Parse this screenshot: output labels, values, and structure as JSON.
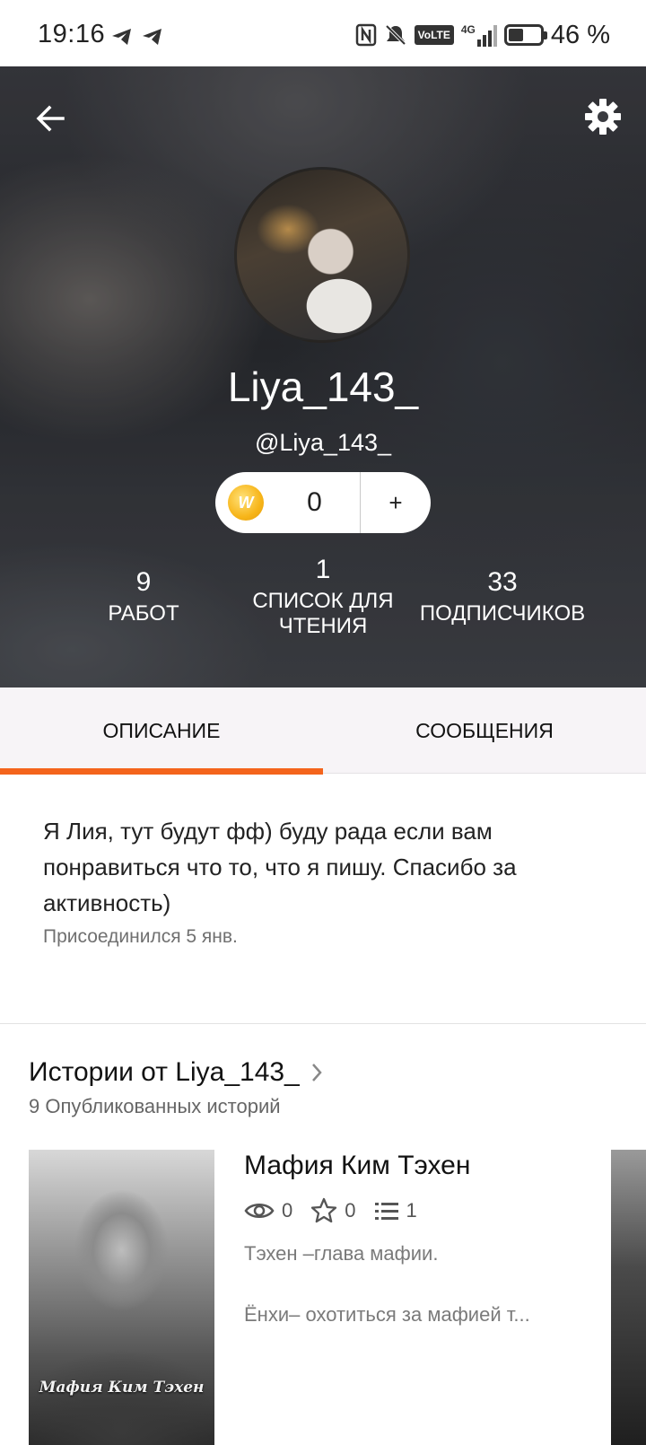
{
  "status_bar": {
    "time": "19:16",
    "volte": "VoLTE",
    "network": "4G",
    "battery": "46 %",
    "battery_level": 0.46
  },
  "header": {
    "display_name": "Liya_143_",
    "username": "@Liya_143_",
    "coins": {
      "count": "0",
      "add_label": "+",
      "coin_glyph": "W"
    },
    "stats": [
      {
        "num": "9",
        "label": "РАБОТ"
      },
      {
        "num": "1",
        "label_line1": "СПИСОК ДЛЯ",
        "label_line2": "ЧТЕНИЯ"
      },
      {
        "num": "33",
        "label": "ПОДПИСЧИКОВ"
      }
    ]
  },
  "tabs": [
    {
      "label": "ОПИСАНИЕ",
      "active": true
    },
    {
      "label": "СООБЩЕНИЯ",
      "active": false
    }
  ],
  "about": {
    "text": "Я Лия, тут будут фф) буду рада если вам понравиться что то, что я пишу. Спасибо за активность)",
    "joined": "Присоединился 5 янв."
  },
  "stories": {
    "title": "Истории от Liya_143_",
    "subtitle": "9 Опубликованных историй",
    "items": [
      {
        "cover_text": "Мафия Ким Тэхен",
        "title": "Мафия Ким Тэхен",
        "views": "0",
        "votes": "0",
        "parts": "1",
        "desc_line1": "Тэхен –глава мафии.",
        "desc_line2": "Ёнхи– охотиться за мафией т..."
      }
    ]
  },
  "colors": {
    "accent": "#f4641c",
    "coin": "#f7b519",
    "tab_bg": "#f7f4f7"
  }
}
